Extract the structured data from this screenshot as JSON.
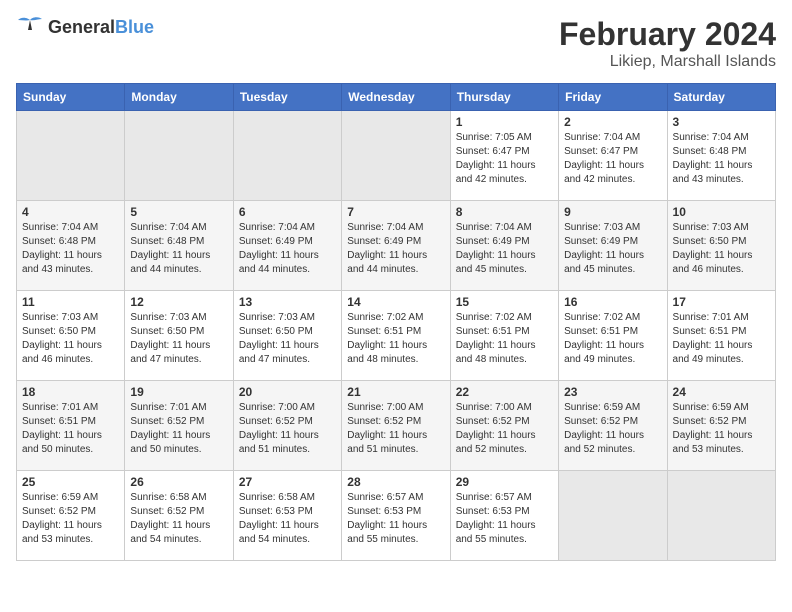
{
  "logo": {
    "general": "General",
    "blue": "Blue"
  },
  "title": {
    "month_year": "February 2024",
    "location": "Likiep, Marshall Islands"
  },
  "weekdays": [
    "Sunday",
    "Monday",
    "Tuesday",
    "Wednesday",
    "Thursday",
    "Friday",
    "Saturday"
  ],
  "weeks": [
    [
      {
        "day": "",
        "sunrise": "",
        "sunset": "",
        "daylight": ""
      },
      {
        "day": "",
        "sunrise": "",
        "sunset": "",
        "daylight": ""
      },
      {
        "day": "",
        "sunrise": "",
        "sunset": "",
        "daylight": ""
      },
      {
        "day": "",
        "sunrise": "",
        "sunset": "",
        "daylight": ""
      },
      {
        "day": "1",
        "sunrise": "Sunrise: 7:05 AM",
        "sunset": "Sunset: 6:47 PM",
        "daylight": "Daylight: 11 hours and 42 minutes."
      },
      {
        "day": "2",
        "sunrise": "Sunrise: 7:04 AM",
        "sunset": "Sunset: 6:47 PM",
        "daylight": "Daylight: 11 hours and 42 minutes."
      },
      {
        "day": "3",
        "sunrise": "Sunrise: 7:04 AM",
        "sunset": "Sunset: 6:48 PM",
        "daylight": "Daylight: 11 hours and 43 minutes."
      }
    ],
    [
      {
        "day": "4",
        "sunrise": "Sunrise: 7:04 AM",
        "sunset": "Sunset: 6:48 PM",
        "daylight": "Daylight: 11 hours and 43 minutes."
      },
      {
        "day": "5",
        "sunrise": "Sunrise: 7:04 AM",
        "sunset": "Sunset: 6:48 PM",
        "daylight": "Daylight: 11 hours and 44 minutes."
      },
      {
        "day": "6",
        "sunrise": "Sunrise: 7:04 AM",
        "sunset": "Sunset: 6:49 PM",
        "daylight": "Daylight: 11 hours and 44 minutes."
      },
      {
        "day": "7",
        "sunrise": "Sunrise: 7:04 AM",
        "sunset": "Sunset: 6:49 PM",
        "daylight": "Daylight: 11 hours and 44 minutes."
      },
      {
        "day": "8",
        "sunrise": "Sunrise: 7:04 AM",
        "sunset": "Sunset: 6:49 PM",
        "daylight": "Daylight: 11 hours and 45 minutes."
      },
      {
        "day": "9",
        "sunrise": "Sunrise: 7:03 AM",
        "sunset": "Sunset: 6:49 PM",
        "daylight": "Daylight: 11 hours and 45 minutes."
      },
      {
        "day": "10",
        "sunrise": "Sunrise: 7:03 AM",
        "sunset": "Sunset: 6:50 PM",
        "daylight": "Daylight: 11 hours and 46 minutes."
      }
    ],
    [
      {
        "day": "11",
        "sunrise": "Sunrise: 7:03 AM",
        "sunset": "Sunset: 6:50 PM",
        "daylight": "Daylight: 11 hours and 46 minutes."
      },
      {
        "day": "12",
        "sunrise": "Sunrise: 7:03 AM",
        "sunset": "Sunset: 6:50 PM",
        "daylight": "Daylight: 11 hours and 47 minutes."
      },
      {
        "day": "13",
        "sunrise": "Sunrise: 7:03 AM",
        "sunset": "Sunset: 6:50 PM",
        "daylight": "Daylight: 11 hours and 47 minutes."
      },
      {
        "day": "14",
        "sunrise": "Sunrise: 7:02 AM",
        "sunset": "Sunset: 6:51 PM",
        "daylight": "Daylight: 11 hours and 48 minutes."
      },
      {
        "day": "15",
        "sunrise": "Sunrise: 7:02 AM",
        "sunset": "Sunset: 6:51 PM",
        "daylight": "Daylight: 11 hours and 48 minutes."
      },
      {
        "day": "16",
        "sunrise": "Sunrise: 7:02 AM",
        "sunset": "Sunset: 6:51 PM",
        "daylight": "Daylight: 11 hours and 49 minutes."
      },
      {
        "day": "17",
        "sunrise": "Sunrise: 7:01 AM",
        "sunset": "Sunset: 6:51 PM",
        "daylight": "Daylight: 11 hours and 49 minutes."
      }
    ],
    [
      {
        "day": "18",
        "sunrise": "Sunrise: 7:01 AM",
        "sunset": "Sunset: 6:51 PM",
        "daylight": "Daylight: 11 hours and 50 minutes."
      },
      {
        "day": "19",
        "sunrise": "Sunrise: 7:01 AM",
        "sunset": "Sunset: 6:52 PM",
        "daylight": "Daylight: 11 hours and 50 minutes."
      },
      {
        "day": "20",
        "sunrise": "Sunrise: 7:00 AM",
        "sunset": "Sunset: 6:52 PM",
        "daylight": "Daylight: 11 hours and 51 minutes."
      },
      {
        "day": "21",
        "sunrise": "Sunrise: 7:00 AM",
        "sunset": "Sunset: 6:52 PM",
        "daylight": "Daylight: 11 hours and 51 minutes."
      },
      {
        "day": "22",
        "sunrise": "Sunrise: 7:00 AM",
        "sunset": "Sunset: 6:52 PM",
        "daylight": "Daylight: 11 hours and 52 minutes."
      },
      {
        "day": "23",
        "sunrise": "Sunrise: 6:59 AM",
        "sunset": "Sunset: 6:52 PM",
        "daylight": "Daylight: 11 hours and 52 minutes."
      },
      {
        "day": "24",
        "sunrise": "Sunrise: 6:59 AM",
        "sunset": "Sunset: 6:52 PM",
        "daylight": "Daylight: 11 hours and 53 minutes."
      }
    ],
    [
      {
        "day": "25",
        "sunrise": "Sunrise: 6:59 AM",
        "sunset": "Sunset: 6:52 PM",
        "daylight": "Daylight: 11 hours and 53 minutes."
      },
      {
        "day": "26",
        "sunrise": "Sunrise: 6:58 AM",
        "sunset": "Sunset: 6:52 PM",
        "daylight": "Daylight: 11 hours and 54 minutes."
      },
      {
        "day": "27",
        "sunrise": "Sunrise: 6:58 AM",
        "sunset": "Sunset: 6:53 PM",
        "daylight": "Daylight: 11 hours and 54 minutes."
      },
      {
        "day": "28",
        "sunrise": "Sunrise: 6:57 AM",
        "sunset": "Sunset: 6:53 PM",
        "daylight": "Daylight: 11 hours and 55 minutes."
      },
      {
        "day": "29",
        "sunrise": "Sunrise: 6:57 AM",
        "sunset": "Sunset: 6:53 PM",
        "daylight": "Daylight: 11 hours and 55 minutes."
      },
      {
        "day": "",
        "sunrise": "",
        "sunset": "",
        "daylight": ""
      },
      {
        "day": "",
        "sunrise": "",
        "sunset": "",
        "daylight": ""
      }
    ]
  ]
}
